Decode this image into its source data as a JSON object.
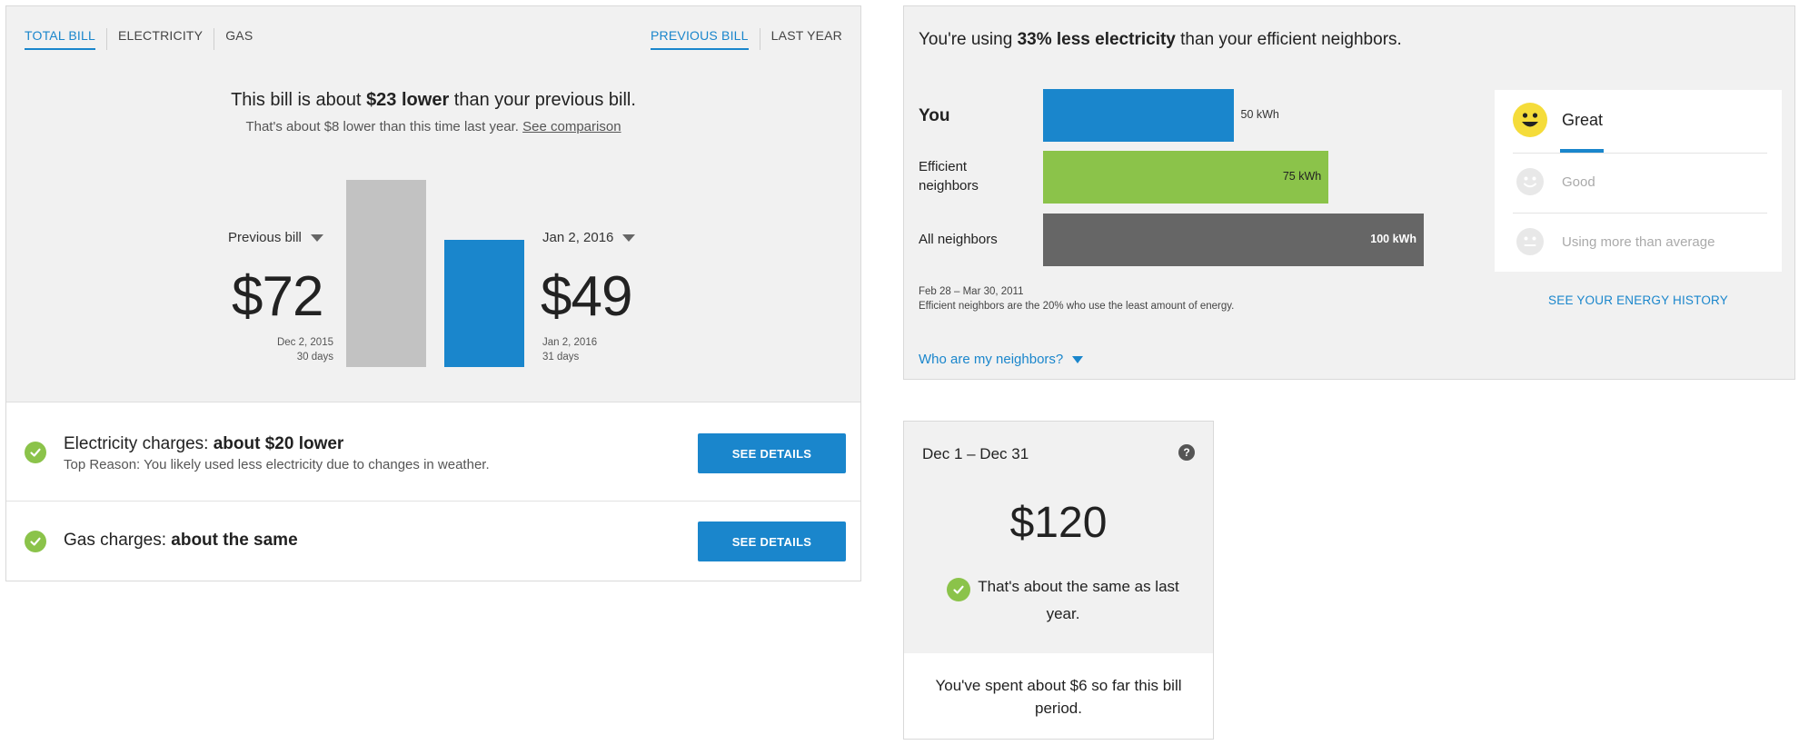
{
  "bill_card": {
    "tabs_left": [
      "TOTAL BILL",
      "ELECTRICITY",
      "GAS"
    ],
    "tabs_right": [
      "PREVIOUS BILL",
      "LAST YEAR"
    ],
    "headline_prefix": "This bill is about ",
    "headline_bold": "$23 lower",
    "headline_suffix": " than your previous bill.",
    "subline_text": "That's about $8 lower than this time last year. ",
    "subline_link": "See comparison",
    "previous": {
      "label": "Previous bill",
      "amount": "$72",
      "date": "Dec 2, 2015",
      "days": "30 days",
      "value": 72
    },
    "current": {
      "label": "Jan 2, 2016",
      "amount": "$49",
      "date": "Jan 2, 2016",
      "days": "31 days",
      "value": 49
    },
    "rows": [
      {
        "title_prefix": "Electricity charges: ",
        "title_bold": "about $20 lower",
        "subtitle": "Top Reason: You likely used less electricity due to changes in weather.",
        "button": "SEE DETAILS"
      },
      {
        "title_prefix": "Gas charges: ",
        "title_bold": "about the same",
        "button": "SEE DETAILS"
      }
    ],
    "colors": {
      "accent": "#1a86cc",
      "previous_bar": "#c2c2c2",
      "check": "#8bc34a"
    }
  },
  "neighbors_card": {
    "headline_prefix": "You're using ",
    "headline_bold": "33% less electricity",
    "headline_suffix": " than your efficient neighbors.",
    "bars": [
      {
        "label": "You",
        "value_label": "50 kWh",
        "value": 50,
        "color": "#1a86cc"
      },
      {
        "label_line1": "Efficient",
        "label_line2": "neighbors",
        "value_label": "75 kWh",
        "value": 75,
        "color": "#8bc34a"
      },
      {
        "label": "All neighbors",
        "value_label": "100 kWh",
        "value": 100,
        "color": "#666666"
      }
    ],
    "footnote_dates": "Feb 28 – Mar 30, 2011",
    "footnote_text": "Efficient neighbors are the 20% who use the least amount of energy.",
    "who_link": "Who are my neighbors?",
    "rating": {
      "items": [
        {
          "label": "Great",
          "icon": "smiley-face-icon",
          "active": true
        },
        {
          "label": "Good",
          "icon": "smile-face-icon",
          "active": false
        },
        {
          "label": "Using more than average",
          "icon": "neutral-face-icon",
          "active": false
        }
      ]
    },
    "history_link": "SEE YOUR ENERGY HISTORY"
  },
  "spend_card": {
    "period": "Dec 1 – Dec 31",
    "help_icon": "?",
    "amount": "$120",
    "comparison": "That's about the same as last year.",
    "spent_text": "You've spent about $6 so far this bill period."
  }
}
